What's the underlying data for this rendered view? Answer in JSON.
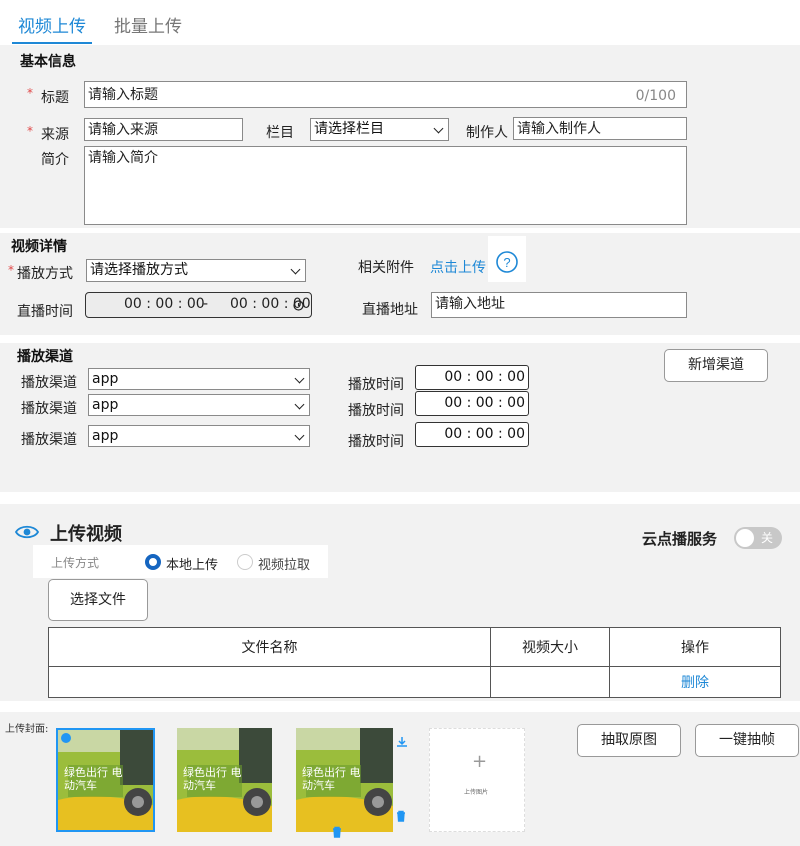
{
  "tabs": {
    "video_upload": "视频上传",
    "batch_upload": "批量上传"
  },
  "basic": {
    "title": "基本信息",
    "title_label": "标题",
    "title_placeholder": "请输入标题",
    "title_count": "0/100",
    "source_label": "来源",
    "source_placeholder": "请输入来源",
    "column_label": "栏目",
    "column_select": "请选择栏目",
    "producer_label": "制作人",
    "producer_placeholder": "请输入制作人",
    "intro_label": "简介",
    "intro_placeholder": "请输入简介",
    "required_mark": "*"
  },
  "details": {
    "title": "视频详情",
    "play_mode_label": "播放方式",
    "play_mode_select": "请选择播放方式",
    "attachment_label": "相关附件",
    "attachment_link": "点击上传",
    "live_time_label": "直播时间",
    "live_time_start": "00 : 00 : 00",
    "live_time_sep": "-",
    "live_time_end": "00 : 00 : 00",
    "live_addr_label": "直播地址",
    "live_addr_placeholder": "请输入地址"
  },
  "channels": {
    "title": "播放渠道",
    "add_button": "新增渠道",
    "rows": [
      {
        "label": "播放渠道",
        "value": "app",
        "time_label": "播放时间",
        "time": "00 : 00 : 00"
      },
      {
        "label": "播放渠道",
        "value": "app",
        "time_label": "播放时间",
        "time": "00 : 00 : 00"
      },
      {
        "label": "播放渠道",
        "value": "app",
        "time_label": "播放时间",
        "time": "00 : 00 : 00"
      }
    ]
  },
  "upload": {
    "title": "上传视频",
    "cloud_label": "云点播服务",
    "toggle_text": "关",
    "toggle_on": false,
    "method_label": "上传方式",
    "method_local": "本地上传",
    "method_pull": "视频拉取",
    "selected_method": "本地上传",
    "choose_file": "选择文件",
    "columns": [
      "文件名称",
      "视频大小",
      "操作"
    ],
    "delete_link": "删除"
  },
  "cover": {
    "label": "上传封面:",
    "extract_original": "抽取原图",
    "one_click_frame": "一键抽帧",
    "upload_image_text": "上传图片",
    "thumbnail_text": "绿色出行 电动汽车"
  },
  "colors": {
    "accent": "#1e88d6",
    "required": "#e04848",
    "panel": "#f2f2f2"
  }
}
